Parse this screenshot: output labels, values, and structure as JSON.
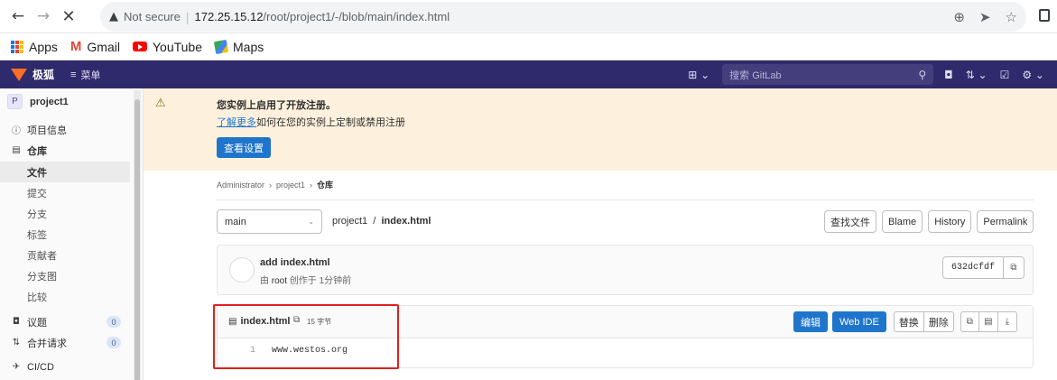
{
  "browser": {
    "security": "Not secure",
    "url_host": "172.25.15.12",
    "url_path": "/root/project1/-/blob/main/index.html"
  },
  "bookmarks": [
    "Apps",
    "Gmail",
    "YouTube",
    "Maps"
  ],
  "gitlab_nav": {
    "brand": "极狐",
    "menu": "菜单",
    "search_placeholder": "搜索 GitLab"
  },
  "sidebar": {
    "avatar_letter": "P",
    "project": "project1",
    "project_info": "项目信息",
    "repository": "仓库",
    "sub_items": [
      "文件",
      "提交",
      "分支",
      "标签",
      "贡献者",
      "分支图",
      "比较"
    ],
    "issues": "议题",
    "issues_count": "0",
    "merge_requests": "合并请求",
    "mr_count": "0",
    "cicd": "CI/CD"
  },
  "alert": {
    "title": "您实例上启用了开放注册。",
    "link": "了解更多",
    "body": "如何在您的实例上定制或禁用注册",
    "button": "查看设置"
  },
  "breadcrumb": [
    "Administrator",
    "project1",
    "仓库"
  ],
  "branch": "main",
  "file_path": {
    "project": "project1",
    "sep": "/",
    "file": "index.html"
  },
  "buttons": [
    "查找文件",
    "Blame",
    "History",
    "Permalink"
  ],
  "commit": {
    "message": "add index.html",
    "meta_prefix": "由",
    "author": "root",
    "meta_suffix": "创作于 1分钟前",
    "sha": "632dcfdf"
  },
  "file": {
    "name": "index.html",
    "size": "15 字节",
    "edit": "编辑",
    "web_ide": "Web IDE",
    "replace": "替换",
    "delete": "删除",
    "line_number": "1",
    "line_content": "www.westos.org"
  },
  "colors": {
    "gitlab_nav": "#2f2a6b",
    "primary_blue": "#1f75cb",
    "alert_bg": "#fdf1dd",
    "highlight_red": "#e0201d"
  }
}
